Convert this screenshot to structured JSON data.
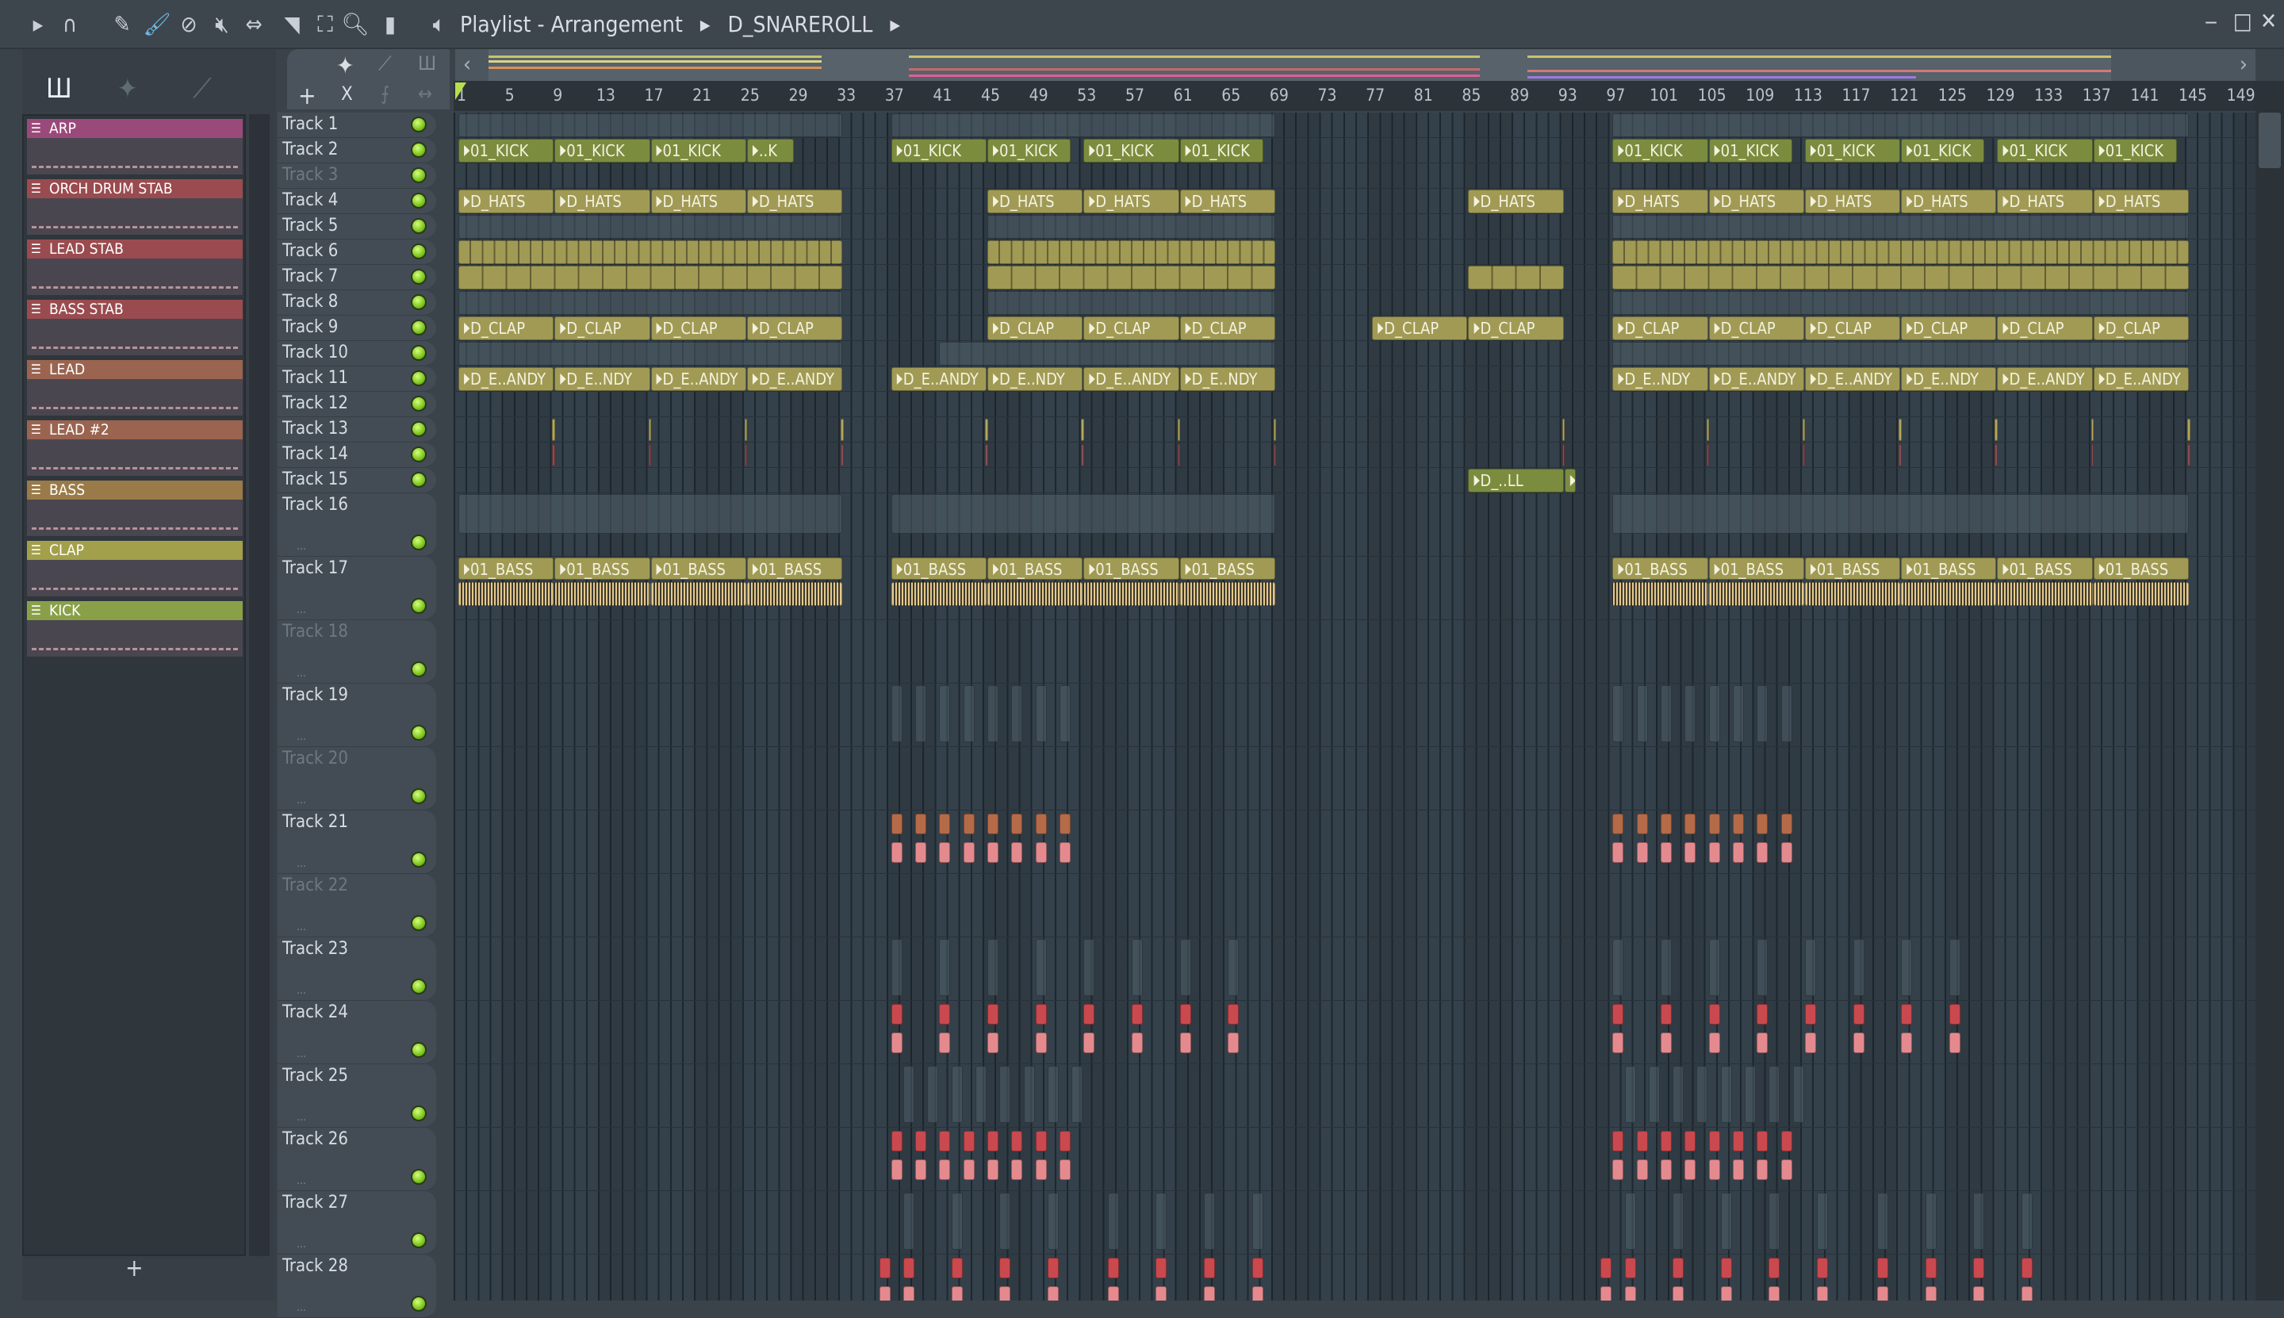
{
  "toolbar": {
    "icons": [
      "arrow-right-icon",
      "magnet-icon",
      "pencil-icon",
      "paint-icon",
      "delete-icon",
      "mute-icon",
      "slip-icon",
      "slice-icon",
      "select-icon",
      "zoom-icon",
      "playback-icon"
    ],
    "speaker_icon": "speaker-icon"
  },
  "title": {
    "window": "Playlist - Arrangement",
    "sep": "▸",
    "pattern": "D_SNAREROLL"
  },
  "window_buttons": {
    "minimize": "‒",
    "maximize": "□",
    "close": "✕"
  },
  "picker": {
    "icons": [
      "piano-icon",
      "audio-icon",
      "automation-icon"
    ],
    "add": "+"
  },
  "channels": [
    {
      "name": "ARP",
      "color": "#9a4a7a"
    },
    {
      "name": "ORCH DRUM STAB",
      "color": "#9a4b4f"
    },
    {
      "name": "LEAD STAB",
      "color": "#9a4b4f"
    },
    {
      "name": "BASS STAB",
      "color": "#9a4b4f"
    },
    {
      "name": "LEAD",
      "color": "#9a6450"
    },
    {
      "name": "LEAD #2",
      "color": "#9a6450"
    },
    {
      "name": "BASS",
      "color": "#9a7a48"
    },
    {
      "name": "CLAP",
      "color": "#a3a04c"
    },
    {
      "name": "KICK",
      "color": "#8aa048"
    }
  ],
  "tools": {
    "add": "+",
    "audio": "✦",
    "auto": "⟋",
    "piano": "Ш",
    "cut": "X",
    "curve": "⨍",
    "stretch": "↔",
    "scroll_left": "‹",
    "scroll_right": "›"
  },
  "ruler": [
    1,
    5,
    9,
    13,
    17,
    21,
    25,
    29,
    33,
    37,
    41,
    45,
    49,
    53,
    57,
    61,
    65,
    69,
    73,
    77,
    81,
    85,
    89,
    93,
    97,
    101,
    105,
    109,
    113,
    117,
    121,
    125,
    129,
    133,
    137,
    141,
    145,
    149
  ],
  "tracks": [
    {
      "name": "Track 1",
      "clips": [
        {
          "s": 1,
          "l": 32,
          "k": "ghost"
        },
        {
          "s": 37,
          "l": 32,
          "k": "ghost"
        },
        {
          "s": 97,
          "l": 48,
          "k": "ghost"
        }
      ]
    },
    {
      "name": "Track 2",
      "clips": [
        {
          "s": 1,
          "l": 8,
          "k": "kick",
          "t": "01_KICK"
        },
        {
          "s": 9,
          "l": 8,
          "k": "kick",
          "t": "01_KICK"
        },
        {
          "s": 17,
          "l": 8,
          "k": "kick",
          "t": "01_KICK"
        },
        {
          "s": 25,
          "l": 4,
          "k": "kick",
          "t": "..K"
        },
        {
          "s": 37,
          "l": 8,
          "k": "kick",
          "t": "01_KICK"
        },
        {
          "s": 45,
          "l": 7,
          "k": "kick",
          "t": "01_KICK"
        },
        {
          "s": 53,
          "l": 8,
          "k": "kick",
          "t": "01_KICK"
        },
        {
          "s": 61,
          "l": 7,
          "k": "kick",
          "t": "01_KICK"
        },
        {
          "s": 97,
          "l": 8,
          "k": "kick",
          "t": "01_KICK"
        },
        {
          "s": 105,
          "l": 7,
          "k": "kick",
          "t": "01_KICK"
        },
        {
          "s": 113,
          "l": 8,
          "k": "kick",
          "t": "01_KICK"
        },
        {
          "s": 121,
          "l": 7,
          "k": "kick",
          "t": "01_KICK"
        },
        {
          "s": 129,
          "l": 8,
          "k": "kick",
          "t": "01_KICK"
        },
        {
          "s": 137,
          "l": 7,
          "k": "kick",
          "t": "01_KICK"
        }
      ]
    },
    {
      "name": "Track 3",
      "dim": true,
      "clips": []
    },
    {
      "name": "Track 4",
      "clips": [
        {
          "s": 1,
          "l": 8,
          "k": "audio",
          "t": "D_HATS"
        },
        {
          "s": 9,
          "l": 8,
          "k": "audio",
          "t": "D_HATS"
        },
        {
          "s": 17,
          "l": 8,
          "k": "audio",
          "t": "D_HATS"
        },
        {
          "s": 25,
          "l": 8,
          "k": "audio",
          "t": "D_HATS"
        },
        {
          "s": 45,
          "l": 8,
          "k": "audio",
          "t": "D_HATS"
        },
        {
          "s": 53,
          "l": 8,
          "k": "audio",
          "t": "D_HATS"
        },
        {
          "s": 61,
          "l": 8,
          "k": "audio",
          "t": "D_HATS"
        },
        {
          "s": 85,
          "l": 8,
          "k": "audio",
          "t": "D_HATS"
        },
        {
          "s": 97,
          "l": 8,
          "k": "audio",
          "t": "D_HATS"
        },
        {
          "s": 105,
          "l": 8,
          "k": "audio",
          "t": "D_HATS"
        },
        {
          "s": 113,
          "l": 8,
          "k": "audio",
          "t": "D_HATS"
        },
        {
          "s": 121,
          "l": 8,
          "k": "audio",
          "t": "D_HATS"
        },
        {
          "s": 129,
          "l": 8,
          "k": "audio",
          "t": "D_HATS"
        },
        {
          "s": 137,
          "l": 8,
          "k": "audio",
          "t": "D_HATS"
        }
      ]
    },
    {
      "name": "Track 5",
      "clips": [
        {
          "s": 1,
          "l": 32,
          "k": "ghost"
        },
        {
          "s": 45,
          "l": 24,
          "k": "ghost"
        },
        {
          "s": 97,
          "l": 48,
          "k": "ghost"
        }
      ]
    },
    {
      "name": "Track 6",
      "clips": [
        {
          "s": 1,
          "l": 32,
          "k": "audio",
          "rep": 1
        },
        {
          "s": 45,
          "l": 24,
          "k": "audio",
          "rep": 1
        },
        {
          "s": 97,
          "l": 48,
          "k": "audio",
          "rep": 1
        }
      ]
    },
    {
      "name": "Track 7",
      "clips": [
        {
          "s": 1,
          "l": 32,
          "k": "audio",
          "rep": 2
        },
        {
          "s": 45,
          "l": 24,
          "k": "audio",
          "rep": 2
        },
        {
          "s": 85,
          "l": 8,
          "k": "audio",
          "rep": 2
        },
        {
          "s": 97,
          "l": 48,
          "k": "audio",
          "rep": 2
        }
      ]
    },
    {
      "name": "Track 8",
      "clips": [
        {
          "s": 1,
          "l": 32,
          "k": "ghost"
        },
        {
          "s": 45,
          "l": 24,
          "k": "ghost"
        },
        {
          "s": 97,
          "l": 48,
          "k": "ghost"
        }
      ]
    },
    {
      "name": "Track 9",
      "clips": [
        {
          "s": 1,
          "l": 8,
          "k": "audio",
          "t": "D_CLAP"
        },
        {
          "s": 9,
          "l": 8,
          "k": "audio",
          "t": "D_CLAP"
        },
        {
          "s": 17,
          "l": 8,
          "k": "audio",
          "t": "D_CLAP"
        },
        {
          "s": 25,
          "l": 8,
          "k": "audio",
          "t": "D_CLAP"
        },
        {
          "s": 45,
          "l": 8,
          "k": "audio",
          "t": "D_CLAP"
        },
        {
          "s": 53,
          "l": 8,
          "k": "audio",
          "t": "D_CLAP"
        },
        {
          "s": 61,
          "l": 8,
          "k": "audio",
          "t": "D_CLAP"
        },
        {
          "s": 77,
          "l": 8,
          "k": "audio",
          "t": "D_CLAP"
        },
        {
          "s": 85,
          "l": 8,
          "k": "audio",
          "t": "D_CLAP"
        },
        {
          "s": 97,
          "l": 8,
          "k": "audio",
          "t": "D_CLAP"
        },
        {
          "s": 105,
          "l": 8,
          "k": "audio",
          "t": "D_CLAP"
        },
        {
          "s": 113,
          "l": 8,
          "k": "audio",
          "t": "D_CLAP"
        },
        {
          "s": 121,
          "l": 8,
          "k": "audio",
          "t": "D_CLAP"
        },
        {
          "s": 129,
          "l": 8,
          "k": "audio",
          "t": "D_CLAP"
        },
        {
          "s": 137,
          "l": 8,
          "k": "audio",
          "t": "D_CLAP"
        }
      ]
    },
    {
      "name": "Track 10",
      "clips": [
        {
          "s": 1,
          "l": 32,
          "k": "ghost"
        },
        {
          "s": 41,
          "l": 28,
          "k": "ghost"
        },
        {
          "s": 97,
          "l": 48,
          "k": "ghost"
        }
      ]
    },
    {
      "name": "Track 11",
      "clips": [
        {
          "s": 1,
          "l": 8,
          "k": "audio",
          "t": "D_E..ANDY"
        },
        {
          "s": 9,
          "l": 8,
          "k": "audio",
          "t": "D_E..NDY"
        },
        {
          "s": 17,
          "l": 8,
          "k": "audio",
          "t": "D_E..ANDY"
        },
        {
          "s": 25,
          "l": 8,
          "k": "audio",
          "t": "D_E..ANDY"
        },
        {
          "s": 37,
          "l": 8,
          "k": "audio",
          "t": "D_E..ANDY"
        },
        {
          "s": 45,
          "l": 8,
          "k": "audio",
          "t": "D_E..NDY"
        },
        {
          "s": 53,
          "l": 8,
          "k": "audio",
          "t": "D_E..ANDY"
        },
        {
          "s": 61,
          "l": 8,
          "k": "audio",
          "t": "D_E..NDY"
        },
        {
          "s": 97,
          "l": 8,
          "k": "audio",
          "t": "D_E..NDY"
        },
        {
          "s": 105,
          "l": 8,
          "k": "audio",
          "t": "D_E..ANDY"
        },
        {
          "s": 113,
          "l": 8,
          "k": "audio",
          "t": "D_E..ANDY"
        },
        {
          "s": 121,
          "l": 8,
          "k": "audio",
          "t": "D_E..NDY"
        },
        {
          "s": 129,
          "l": 8,
          "k": "audio",
          "t": "D_E..ANDY"
        },
        {
          "s": 137,
          "l": 8,
          "k": "audio",
          "t": "D_E..ANDY"
        }
      ]
    },
    {
      "name": "Track 12",
      "clips": []
    },
    {
      "name": "Track 13",
      "clips": [
        {
          "s": 8.8,
          "l": 0.3,
          "k": "thin-y"
        },
        {
          "s": 16.8,
          "l": 0.3,
          "k": "thin-y"
        },
        {
          "s": 24.8,
          "l": 0.3,
          "k": "thin-y"
        },
        {
          "s": 32.8,
          "l": 0.3,
          "k": "thin-y"
        },
        {
          "s": 44.8,
          "l": 0.3,
          "k": "thin-y"
        },
        {
          "s": 52.8,
          "l": 0.3,
          "k": "thin-y"
        },
        {
          "s": 60.8,
          "l": 0.3,
          "k": "thin-y"
        },
        {
          "s": 68.8,
          "l": 0.3,
          "k": "thin-y"
        },
        {
          "s": 92.8,
          "l": 0.3,
          "k": "thin-y"
        },
        {
          "s": 104.8,
          "l": 0.3,
          "k": "thin-y"
        },
        {
          "s": 112.8,
          "l": 0.3,
          "k": "thin-y"
        },
        {
          "s": 120.8,
          "l": 0.3,
          "k": "thin-y"
        },
        {
          "s": 128.8,
          "l": 0.3,
          "k": "thin-y"
        },
        {
          "s": 136.8,
          "l": 0.3,
          "k": "thin-y"
        },
        {
          "s": 144.8,
          "l": 0.3,
          "k": "thin-y"
        }
      ]
    },
    {
      "name": "Track 14",
      "clips": [
        {
          "s": 8.8,
          "l": 0.3,
          "k": "thin-r"
        },
        {
          "s": 16.8,
          "l": 0.3,
          "k": "thin-r"
        },
        {
          "s": 24.8,
          "l": 0.3,
          "k": "thin-r"
        },
        {
          "s": 32.8,
          "l": 0.3,
          "k": "thin-r"
        },
        {
          "s": 44.8,
          "l": 0.3,
          "k": "thin-r"
        },
        {
          "s": 52.8,
          "l": 0.3,
          "k": "thin-r"
        },
        {
          "s": 60.8,
          "l": 0.3,
          "k": "thin-r"
        },
        {
          "s": 68.8,
          "l": 0.3,
          "k": "thin-r"
        },
        {
          "s": 92.8,
          "l": 0.3,
          "k": "thin-r"
        },
        {
          "s": 104.8,
          "l": 0.3,
          "k": "thin-r"
        },
        {
          "s": 112.8,
          "l": 0.3,
          "k": "thin-r"
        },
        {
          "s": 120.8,
          "l": 0.3,
          "k": "thin-r"
        },
        {
          "s": 128.8,
          "l": 0.3,
          "k": "thin-r"
        },
        {
          "s": 136.8,
          "l": 0.3,
          "k": "thin-r"
        },
        {
          "s": 144.8,
          "l": 0.3,
          "k": "thin-r"
        }
      ]
    },
    {
      "name": "Track 15",
      "clips": [
        {
          "s": 85,
          "l": 8,
          "k": "kick",
          "t": "D_..LL"
        },
        {
          "s": 93,
          "l": 1,
          "k": "kick",
          "t": ""
        }
      ]
    },
    {
      "name": "Track 16",
      "big": true,
      "clips": [
        {
          "s": 1,
          "l": 32,
          "k": "ghost"
        },
        {
          "s": 37,
          "l": 32,
          "k": "ghost"
        },
        {
          "s": 97,
          "l": 48,
          "k": "ghost"
        }
      ]
    },
    {
      "name": "Track 17",
      "big": true,
      "clips": [
        {
          "s": 1,
          "l": 8,
          "k": "audio",
          "t": "01_BASS",
          "w": 1
        },
        {
          "s": 9,
          "l": 8,
          "k": "audio",
          "t": "01_BASS",
          "w": 1
        },
        {
          "s": 17,
          "l": 8,
          "k": "audio",
          "t": "01_BASS",
          "w": 1
        },
        {
          "s": 25,
          "l": 8,
          "k": "audio",
          "t": "01_BASS",
          "w": 1
        },
        {
          "s": 37,
          "l": 8,
          "k": "audio",
          "t": "01_BASS",
          "w": 1
        },
        {
          "s": 45,
          "l": 8,
          "k": "audio",
          "t": "01_BASS",
          "w": 1
        },
        {
          "s": 53,
          "l": 8,
          "k": "audio",
          "t": "01_BASS",
          "w": 1
        },
        {
          "s": 61,
          "l": 8,
          "k": "audio",
          "t": "01_BASS",
          "w": 1
        },
        {
          "s": 97,
          "l": 8,
          "k": "audio",
          "t": "01_BASS",
          "w": 1
        },
        {
          "s": 105,
          "l": 8,
          "k": "audio",
          "t": "01_BASS",
          "w": 1
        },
        {
          "s": 113,
          "l": 8,
          "k": "audio",
          "t": "01_BASS",
          "w": 1
        },
        {
          "s": 121,
          "l": 8,
          "k": "audio",
          "t": "01_BASS",
          "w": 1
        },
        {
          "s": 129,
          "l": 8,
          "k": "audio",
          "t": "01_BASS",
          "w": 1
        },
        {
          "s": 137,
          "l": 8,
          "k": "audio",
          "t": "01_BASS",
          "w": 1
        }
      ]
    },
    {
      "name": "Track 18",
      "big": true,
      "dim": true,
      "clips": []
    },
    {
      "name": "Track 19",
      "big": true,
      "seq": {
        "kind": "ghost",
        "starts": [
          37,
          39,
          41,
          43,
          45,
          47,
          49,
          51,
          97,
          99,
          101,
          103,
          105,
          107,
          109,
          111
        ]
      }
    },
    {
      "name": "Track 20",
      "big": true,
      "dim": true,
      "clips": []
    },
    {
      "name": "Track 21",
      "big": true,
      "seq": {
        "kind": "mini",
        "starts": [
          37,
          39,
          41,
          43,
          45,
          47,
          49,
          51,
          97,
          99,
          101,
          103,
          105,
          107,
          109,
          111
        ]
      }
    },
    {
      "name": "Track 22",
      "big": true,
      "dim": true,
      "clips": []
    },
    {
      "name": "Track 23",
      "big": true,
      "seq": {
        "kind": "ghost",
        "starts": [
          37,
          41,
          45,
          49,
          53,
          57,
          61,
          65,
          97,
          101,
          105,
          109,
          113,
          117,
          121,
          125
        ]
      }
    },
    {
      "name": "Track 24",
      "big": true,
      "seq": {
        "kind": "minired",
        "starts": [
          37,
          41,
          45,
          49,
          53,
          57,
          61,
          65,
          97,
          101,
          105,
          109,
          113,
          117,
          121,
          125
        ]
      }
    },
    {
      "name": "Track 25",
      "big": true,
      "seq": {
        "kind": "ghost",
        "starts": [
          38,
          40,
          42,
          44,
          46,
          48,
          50,
          52,
          98,
          100,
          102,
          104,
          106,
          108,
          110,
          112
        ]
      }
    },
    {
      "name": "Track 26",
      "big": true,
      "seq": {
        "kind": "minired",
        "starts": [
          37,
          39,
          41,
          43,
          45,
          47,
          49,
          51,
          97,
          99,
          101,
          103,
          105,
          107,
          109,
          111
        ]
      }
    },
    {
      "name": "Track 27",
      "big": true,
      "seq": {
        "kind": "ghost",
        "starts": [
          38,
          42,
          46,
          50,
          55,
          59,
          63,
          67,
          98,
          102,
          106,
          110,
          114,
          119,
          123,
          127,
          131
        ]
      }
    },
    {
      "name": "Track 28",
      "big": true,
      "seq": {
        "kind": "minired",
        "starts": [
          36,
          38,
          42,
          46,
          50,
          55,
          59,
          63,
          67,
          96,
          98,
          102,
          106,
          110,
          114,
          119,
          123,
          127,
          131
        ]
      }
    }
  ],
  "colors": {
    "kick": "#7b8c3f",
    "audio": "#a09a55",
    "led": "#7cc51e",
    "playhead": "#b6e04a"
  }
}
